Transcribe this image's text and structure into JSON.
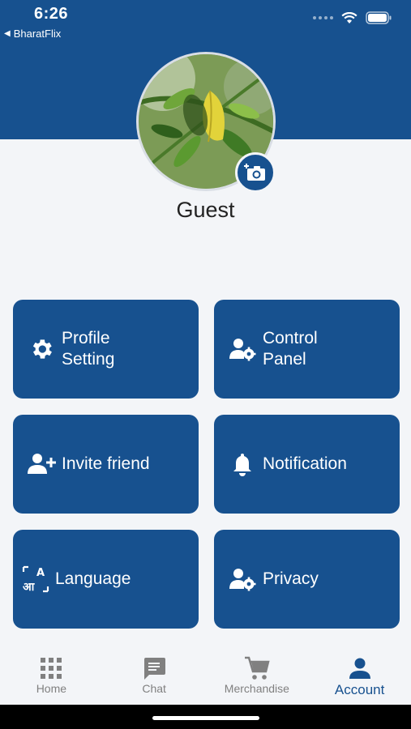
{
  "status": {
    "time": "6:26",
    "back_app": "BharatFlix"
  },
  "profile": {
    "name": "Guest"
  },
  "cards": [
    {
      "label": "Profile Setting",
      "icon": "gear-icon"
    },
    {
      "label": "Control Panel",
      "icon": "user-gear-icon"
    },
    {
      "label": "Invite friend",
      "icon": "user-plus-icon"
    },
    {
      "label": "Notification",
      "icon": "bell-icon"
    },
    {
      "label": "Language",
      "icon": "translate-icon"
    },
    {
      "label": "Privacy",
      "icon": "user-gear-icon"
    }
  ],
  "nav": {
    "items": [
      {
        "label": "Home",
        "icon": "grid-icon"
      },
      {
        "label": "Chat",
        "icon": "chat-icon"
      },
      {
        "label": "Merchandise",
        "icon": "cart-icon"
      },
      {
        "label": "Account",
        "icon": "person-icon"
      }
    ],
    "active": "Account"
  },
  "colors": {
    "primary": "#17518f",
    "background": "#f3f5f8",
    "inactive": "#808080"
  }
}
